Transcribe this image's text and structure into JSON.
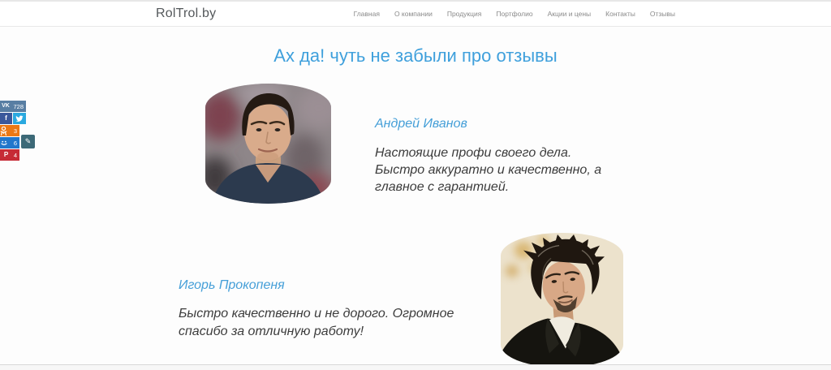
{
  "header": {
    "logo": "RolTrol.by",
    "nav": [
      "Главная",
      "О компании",
      "Продукция",
      "Портфолио",
      "Акции и цены",
      "Контакты",
      "Отзывы"
    ]
  },
  "main": {
    "heading": "Ах да! чуть не забыли про отзывы"
  },
  "share": {
    "vk": {
      "label": "VK",
      "count": "728",
      "color": "#587ea3"
    },
    "facebook": {
      "label": "f",
      "color": "#3a589b"
    },
    "twitter": {
      "color": "#2aa9e0"
    },
    "odnoklassniki": {
      "count": "3",
      "color": "#eb7815"
    },
    "mailru": {
      "count": "6",
      "color": "#2277cc"
    },
    "pinterest": {
      "label": "P",
      "count": "4",
      "color": "#c62b36"
    },
    "settings": {
      "label": "✎",
      "color": "#3c6977"
    }
  },
  "testimonials": [
    {
      "name": "Андрей Иванов",
      "text": "Настоящие профи своего дела. Быстро аккуратно и качественно, а главное с гарантией."
    },
    {
      "name": "Игорь Прокопеня",
      "text": "Быстро качественно и не дорого. Огромное спасибо за отличную работу!"
    }
  ],
  "colors": {
    "accent_heading": "#3fa0dc",
    "name_blue": "#459fd8",
    "body_text": "#3c3c3c",
    "nav_text": "#8a8a8a",
    "logo_text": "#54585b"
  }
}
